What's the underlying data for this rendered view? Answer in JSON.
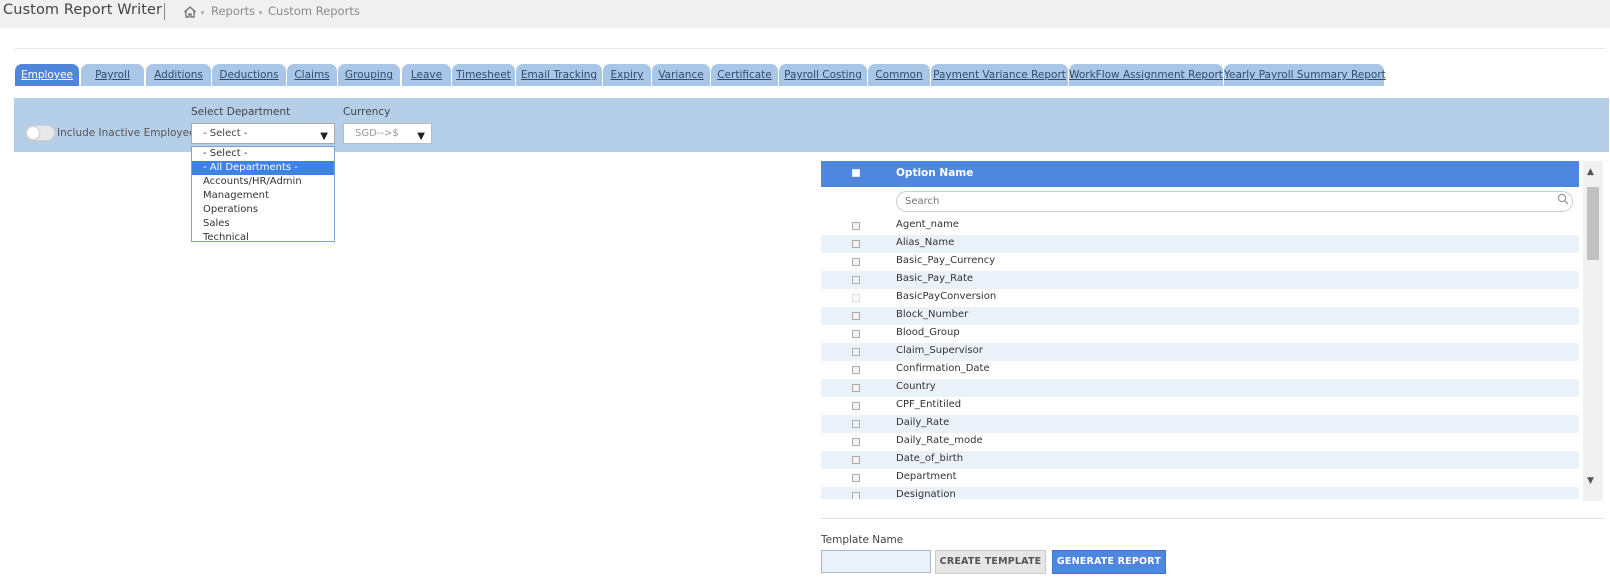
{
  "header": {
    "title": "Custom Report Writer",
    "breadcrumb": [
      "Reports",
      "Custom Reports"
    ]
  },
  "tabs": [
    {
      "label": "Employee",
      "active": true
    },
    {
      "label": "Payroll"
    },
    {
      "label": "Additions"
    },
    {
      "label": "Deductions"
    },
    {
      "label": "Claims"
    },
    {
      "label": "Grouping"
    },
    {
      "label": "Leave"
    },
    {
      "label": "Timesheet"
    },
    {
      "label": "Email Tracking"
    },
    {
      "label": "Expiry"
    },
    {
      "label": "Variance"
    },
    {
      "label": "Certificate"
    },
    {
      "label": "Payroll Costing"
    },
    {
      "label": "Common"
    },
    {
      "label": "Payment Variance Report"
    },
    {
      "label": "WorkFlow Assignment Report"
    },
    {
      "label": "Yearly Payroll Summary Report"
    }
  ],
  "filters": {
    "include_inactive_label": "Include Inactive Employee",
    "include_inactive": false,
    "department_label": "Select Department",
    "department_value": "- Select -",
    "department_options": [
      "- Select -",
      "- All Departments -",
      "Accounts/HR/Admin",
      "Management",
      "Operations",
      "Sales",
      "Technical"
    ],
    "department_highlighted": "- All Departments -",
    "currency_label": "Currency",
    "currency_value": "SGD-->$"
  },
  "options": {
    "header_label": "Option Name",
    "search_placeholder": "Search",
    "items": [
      "Agent_name",
      "Alias_Name",
      "Basic_Pay_Currency",
      "Basic_Pay_Rate",
      "BasicPayConversion",
      "Block_Number",
      "Blood_Group",
      "Claim_Supervisor",
      "Confirmation_Date",
      "Country",
      "CPF_Entitiled",
      "Daily_Rate",
      "Daily_Rate_mode",
      "Date_of_birth",
      "Department",
      "Designation"
    ],
    "disabled_items": [
      "BasicPayConversion"
    ]
  },
  "footer": {
    "template_label": "Template Name",
    "create_label": "CREATE TEMPLATE",
    "generate_label": "GENERATE REPORT"
  },
  "colors": {
    "accent": "#4f86e0",
    "tab": "#a9c6e7",
    "filter_bar": "#b6cfe9",
    "row_stripe": "#eaf1f9"
  }
}
